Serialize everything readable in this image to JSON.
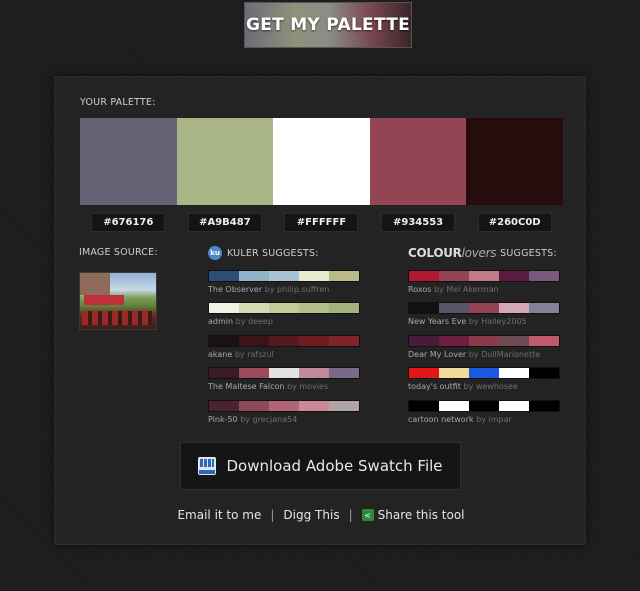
{
  "header": {
    "get_palette_label": "GET MY PALETTE"
  },
  "palette": {
    "label": "YOUR PALETTE:",
    "colors": [
      "#676176",
      "#A9B487",
      "#FFFFFF",
      "#934553",
      "#260C0D"
    ],
    "hex_labels": [
      "#676176",
      "#A9B487",
      "#FFFFFF",
      "#934553",
      "#260C0D"
    ]
  },
  "image_source": {
    "label": "IMAGE SOURCE:"
  },
  "kuler": {
    "title": "KULER SUGGESTS:",
    "icon_text": "ku",
    "items": [
      {
        "name": "The Observer",
        "by": "by",
        "author": "philip.suffren",
        "colors": [
          "#2b4f74",
          "#8fb3c9",
          "#a6c4d3",
          "#e8ead0",
          "#b9b98a"
        ]
      },
      {
        "name": "admin",
        "by": "by",
        "author": "deeep",
        "colors": [
          "#f2f2e4",
          "#d6dcb2",
          "#c2cc97",
          "#b2bf88",
          "#a2b27a"
        ]
      },
      {
        "name": "akane",
        "by": "by",
        "author": "rafszul",
        "colors": [
          "#181212",
          "#3a1416",
          "#561a1c",
          "#6e1e20",
          "#7e2426"
        ]
      },
      {
        "name": "The Maltese Falcon",
        "by": "by",
        "author": "movies",
        "colors": [
          "#3a1a26",
          "#9a4a58",
          "#e2e2e2",
          "#c28a98",
          "#7a6a8a"
        ]
      },
      {
        "name": "Pink-50",
        "by": "by",
        "author": "grecjana54",
        "colors": [
          "#4a2232",
          "#8e4a5a",
          "#b06474",
          "#cc8a96",
          "#b0a4a6"
        ]
      }
    ]
  },
  "colourlovers": {
    "logo_bold": "COLOUR",
    "logo_italic": "lovers",
    "title_suffix": "SUGGESTS:",
    "items": [
      {
        "name": "Roxos",
        "by": "by",
        "author": "Mel Akerman",
        "colors": [
          "#b21832",
          "#934553",
          "#c07a8a",
          "#5a1a42",
          "#7a5a7c"
        ]
      },
      {
        "name": "New Years Eve",
        "by": "by",
        "author": "Hailey2005",
        "colors": [
          "#121212",
          "#575666",
          "#934553",
          "#d4a6b8",
          "#878099"
        ]
      },
      {
        "name": "Dear My Lover",
        "by": "by",
        "author": "DullMarionette",
        "colors": [
          "#4a1a3a",
          "#6e1e3e",
          "#8a3a4a",
          "#6e4a52",
          "#c05a6a"
        ]
      },
      {
        "name": "today's outfit",
        "by": "by",
        "author": "wewhosee",
        "colors": [
          "#e21818",
          "#f2dc9a",
          "#1a5ae2",
          "#ffffff",
          "#000000"
        ]
      },
      {
        "name": "cartoon network",
        "by": "by",
        "author": "impar",
        "colors": [
          "#000000",
          "#ffffff",
          "#000000",
          "#ffffff",
          "#000000"
        ]
      }
    ]
  },
  "download": {
    "label": "Download Adobe Swatch File",
    "icon_name": "swatch-file-icon"
  },
  "footer": {
    "email_label": "Email it to me",
    "digg_label": "Digg This",
    "share_label": "Share this tool",
    "separator": "|"
  }
}
